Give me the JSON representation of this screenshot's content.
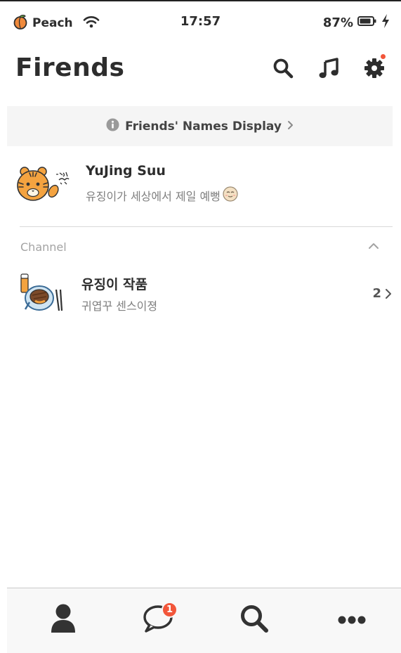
{
  "status_bar": {
    "carrier": "Peach",
    "time": "17:57",
    "battery": "87%"
  },
  "header": {
    "title": "Firends",
    "icons": [
      "search-icon",
      "music-icon",
      "gear-icon"
    ],
    "settings_has_notification": true
  },
  "banner": {
    "text": "Friends' Names Display",
    "icon": "info-icon"
  },
  "profile": {
    "name": "YuJing Suu",
    "status": "유징이가 세상에서 제일 예뻥"
  },
  "channel_section": {
    "title": "Channel",
    "items": [
      {
        "name": "유징이 작품",
        "subtitle": "귀엽꾸 센스이졍",
        "count": "2"
      }
    ]
  },
  "tab_bar": {
    "tabs": [
      "friends-tab",
      "chats-tab",
      "search-tab",
      "more-tab"
    ],
    "chats_badge": "1"
  },
  "colors": {
    "accent": "#f2563a",
    "text": "#2d2d2d",
    "muted": "#808080"
  }
}
